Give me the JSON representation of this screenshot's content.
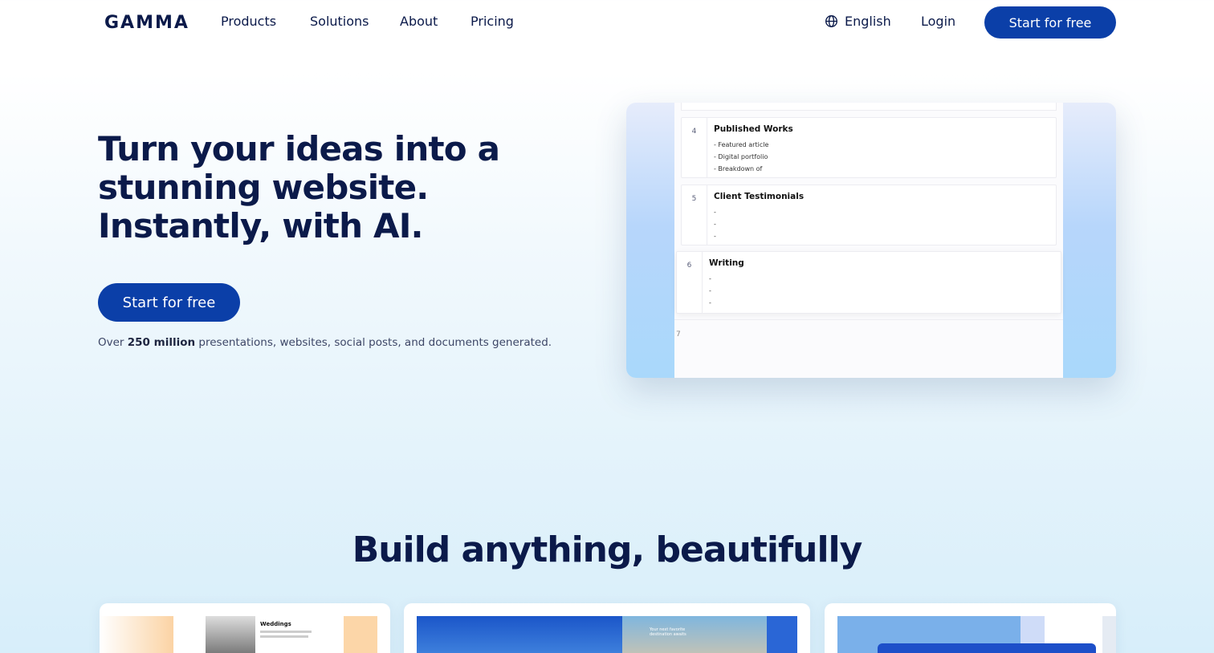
{
  "nav": {
    "logo": "GAMMA",
    "links": [
      "Products",
      "Solutions",
      "About",
      "Pricing"
    ],
    "language": "English",
    "login": "Login",
    "cta": "Start for free"
  },
  "hero": {
    "title": "Turn your ideas into a stunning website. Instantly, with AI.",
    "cta": "Start for free",
    "sub_prefix": "Over ",
    "sub_bold": "250 million",
    "sub_suffix": " presentations, websites, social posts, and documents generated."
  },
  "preview": {
    "rows": [
      {
        "num": "4",
        "heading": "Published Works",
        "items": [
          "- Featured article",
          "- Digital portfolio",
          "- Breakdown of"
        ]
      },
      {
        "num": "5",
        "heading": "Client Testimonials",
        "items": [
          "-",
          "-",
          "-"
        ]
      },
      {
        "num": "6",
        "heading": "Writing",
        "items": [
          "-",
          "-",
          "-"
        ]
      }
    ],
    "next_num": "7"
  },
  "section": {
    "title": "Build anything, beautifully"
  },
  "cards": {
    "card1_label": "Weddings",
    "card2_label": "Your next favorite destination awaits"
  },
  "colors": {
    "primary": "#0b3fa8",
    "text": "#0b1a4a"
  }
}
